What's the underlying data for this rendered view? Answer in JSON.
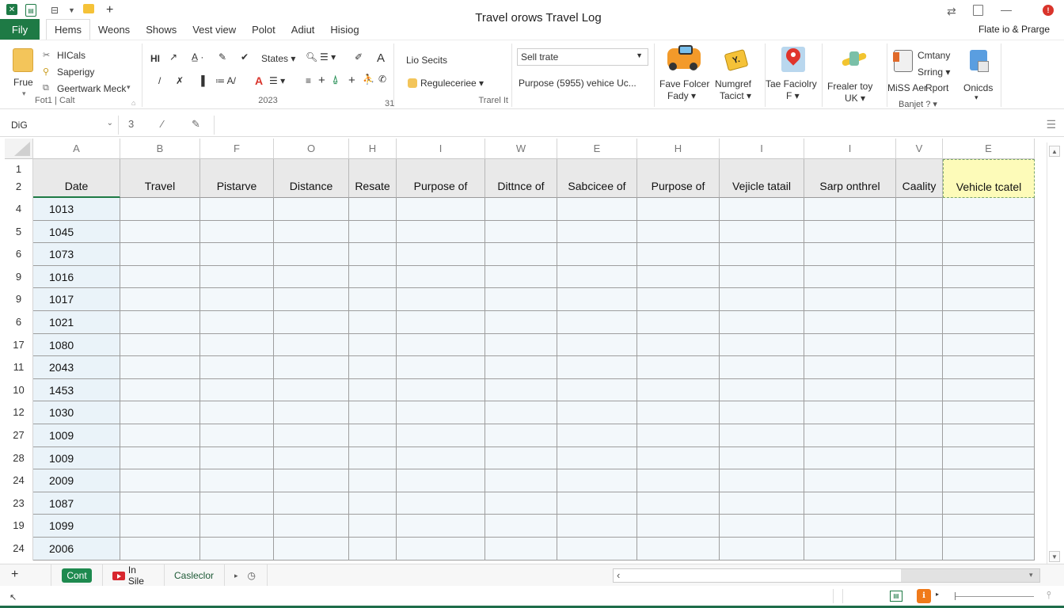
{
  "title_bar": {
    "document_title": "Travel orows Travel Log",
    "share_label": "Flate io & Prarge"
  },
  "tabs": {
    "file": "Fily",
    "items": [
      {
        "label": "Hems",
        "active": true
      },
      {
        "label": "Weons",
        "active": false
      },
      {
        "label": "Shows",
        "active": false
      },
      {
        "label": "Vest view",
        "active": false
      },
      {
        "label": "Polot",
        "active": false
      },
      {
        "label": "Adiut",
        "active": false
      },
      {
        "label": "Hisiog",
        "active": false
      }
    ]
  },
  "ribbon": {
    "clipboard": {
      "paste": "Frue",
      "items": [
        "HICals",
        "Saperigy",
        "Geertwark Meck"
      ],
      "group_label": "Fot1 | Calt"
    },
    "font": {
      "style_dropdown": "States",
      "group_label": "2023"
    },
    "misc_group_label": "31",
    "travel": {
      "series": "Lio Secits",
      "regulate": "Reguleceriee",
      "group_label": "Trarel It"
    },
    "style_select": {
      "value": "Sell trate",
      "purpose_text": "Purpose (5955) vehice Uc..."
    },
    "big_buttons": [
      {
        "label1": "Fave Folcer",
        "label2": "Fady",
        "icon": "car-icon"
      },
      {
        "label1": "Numgref",
        "label2": "Tacict",
        "icon": "tag-icon"
      },
      {
        "label1": "Tae Faciolry",
        "label2": "F",
        "icon": "map-pin-icon"
      },
      {
        "label1": "Frealer toy",
        "label2": "UK",
        "icon": "airplane-icon"
      }
    ],
    "report": {
      "company": "Cmtany",
      "string": "Srring",
      "miss": "MiSS Aer",
      "report": "Rport",
      "budget": "Banjet",
      "onicds": "Onicds"
    }
  },
  "formula_bar": {
    "name_box": "DiG",
    "fx_label": "3",
    "formula_value": ""
  },
  "grid": {
    "column_letters": [
      "A",
      "B",
      "F",
      "O",
      "H",
      "I",
      "W",
      "E",
      "H",
      "I",
      "I",
      "V",
      "E"
    ],
    "header_rows": [
      "1",
      "2"
    ],
    "headers": [
      "Date",
      "Travel",
      "Pistarve",
      "Distance",
      "Resate",
      "Purpose of",
      "Dittnce of",
      "Sabcicee of",
      "Purpose of",
      "Vejicle tatail",
      "Sarp onthrel",
      "Caality",
      "Vehicle tcatel"
    ],
    "rows": [
      {
        "row": "4",
        "date": "1013"
      },
      {
        "row": "5",
        "date": "1045"
      },
      {
        "row": "6",
        "date": "1073"
      },
      {
        "row": "9",
        "date": "1016"
      },
      {
        "row": "9",
        "date": "1017"
      },
      {
        "row": "6",
        "date": "1021"
      },
      {
        "row": "17",
        "date": "1080"
      },
      {
        "row": "11",
        "date": "2043"
      },
      {
        "row": "10",
        "date": "1453"
      },
      {
        "row": "12",
        "date": "1030"
      },
      {
        "row": "27",
        "date": "1009"
      },
      {
        "row": "28",
        "date": "1009"
      },
      {
        "row": "24",
        "date": "2009"
      },
      {
        "row": "23",
        "date": "1087"
      },
      {
        "row": "19",
        "date": "1099"
      },
      {
        "row": "24",
        "date": "2006"
      }
    ]
  },
  "sheets": {
    "tabs": [
      {
        "label": "Cont",
        "active": true
      },
      {
        "label": "In Sile",
        "active": false
      },
      {
        "label": "Casleclor",
        "active": false
      }
    ]
  },
  "colors": {
    "accent_green": "#1e7a45",
    "note_yellow": "#fdfbb9",
    "alert_red": "#d9342b",
    "status_orange": "#f07a1a"
  }
}
